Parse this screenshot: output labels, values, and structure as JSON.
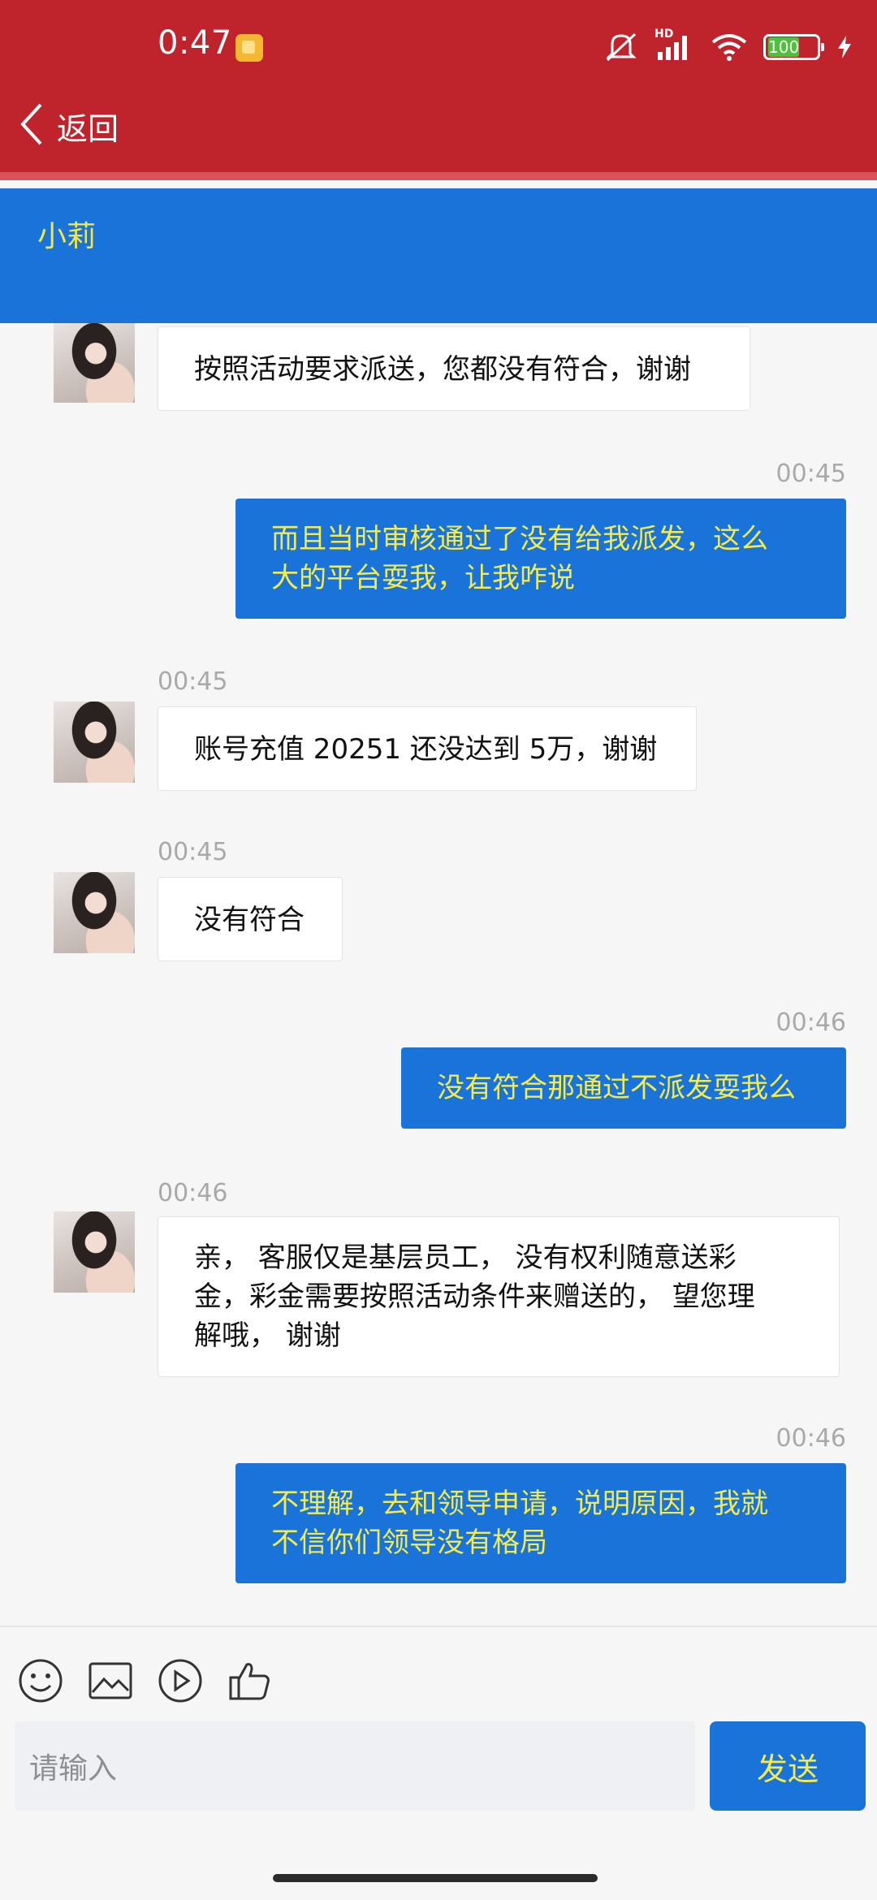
{
  "status_bar": {
    "time": "0:47",
    "battery": "100",
    "network_label": "HD"
  },
  "header": {
    "back_label": "返回"
  },
  "contact": {
    "name": "小莉"
  },
  "messages": [
    {
      "side": "in",
      "time": "",
      "lines": [
        "按照活动要求派送，您都没有符合，谢谢"
      ]
    },
    {
      "side": "out",
      "time": "00:45",
      "lines": [
        "而且当时审核通过了没有给我派发，这么",
        "大的平台耍我，让我咋说"
      ]
    },
    {
      "side": "in",
      "time": "00:45",
      "lines": [
        "账号充值 20251 还没达到 5万，谢谢"
      ]
    },
    {
      "side": "in",
      "time": "00:45",
      "lines": [
        "没有符合"
      ]
    },
    {
      "side": "out",
      "time": "00:46",
      "lines": [
        "没有符合那通过不派发耍我么"
      ]
    },
    {
      "side": "in",
      "time": "00:46",
      "lines": [
        "亲， 客服仅是基层员工， 没有权利随意送彩",
        "金，彩金需要按照活动条件来赠送的， 望您理",
        "解哦， 谢谢"
      ]
    },
    {
      "side": "out",
      "time": "00:46",
      "lines": [
        "不理解，去和领导申请，说明原因，我就",
        "不信你们领导没有格局"
      ]
    }
  ],
  "composer": {
    "placeholder": "请输入",
    "send_label": "发送",
    "tools": [
      "emoji-icon",
      "image-icon",
      "video-icon",
      "thumbs-up-icon"
    ]
  },
  "colors": {
    "header_red": "#bf232b",
    "accent_blue": "#1a73d9",
    "out_text_yellow": "#f4ec4e"
  }
}
